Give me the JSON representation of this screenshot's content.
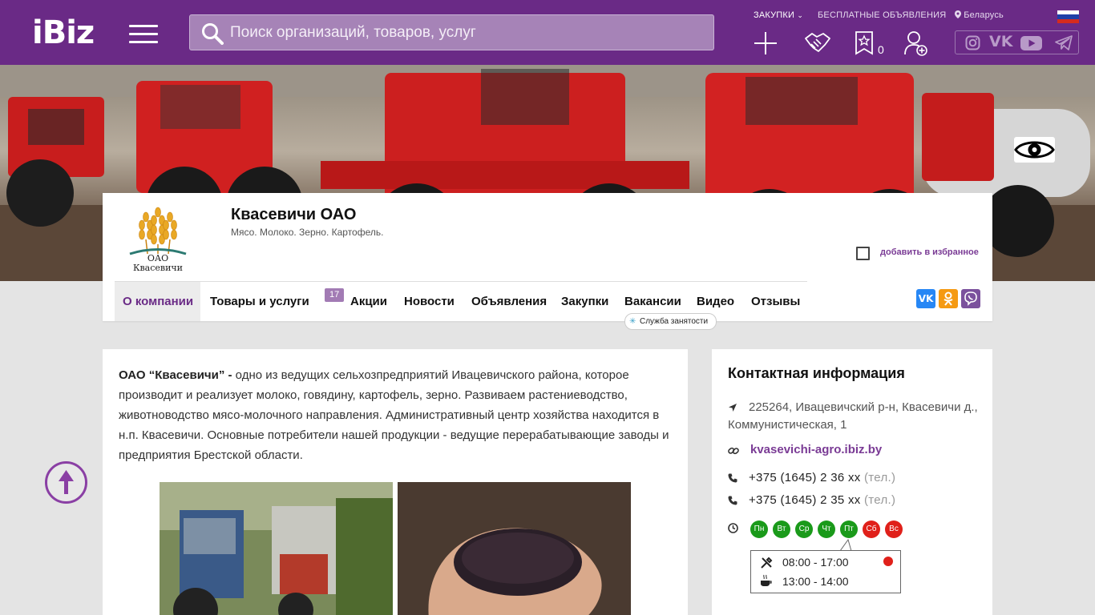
{
  "header": {
    "logo": "iBiz",
    "search_placeholder": "Поиск организаций, товаров, услуг",
    "links": {
      "procurement": "ЗАКУПКИ",
      "free_ads": "БЕСПЛАТНЫЕ ОБЪЯВЛЕНИЯ",
      "region": "Беларусь"
    },
    "favorites_count": "0",
    "colors": {
      "bar": "#6a2a86",
      "search": "#a683b7"
    }
  },
  "company": {
    "name": "Квасевичи ОАО",
    "tagline": "Мясо. Молоко. Зерно. Картофель.",
    "logo_text_1": "ОАО",
    "logo_text_2": "Квасевичи",
    "add_favorite": "добавить в избранное"
  },
  "tabs": [
    {
      "label": "О компании"
    },
    {
      "label": "Товары и услуги"
    },
    {
      "label": "Акции"
    },
    {
      "label": "Новости"
    },
    {
      "label": "Объявления"
    },
    {
      "label": "Закупки"
    },
    {
      "label": "Вакансии"
    },
    {
      "label": "Видео"
    },
    {
      "label": "Отзывы"
    }
  ],
  "tab_badge": "17",
  "service_tag": "Служба занятости",
  "about": {
    "lead": "ОАО “Квасевичи” -",
    "text": " одно из ведущих сельхозпредприятий Ивацевичского района, которое производит и реализует молоко, говядину, картофель, зерно. Развиваем растениеводство, животноводство мясо-молочного направления. Административный центр хозяйства находится в н.п. Квасевичи. Основные потребители нашей продукции - ведущие перерабатывающие заводы и предприятия Брестской области."
  },
  "contacts": {
    "title": "Контактная информация",
    "address": "225264, Ивацевичский р-н, Квасевичи д., Коммунистическая, 1",
    "site": "kvasevichi-agro.ibiz.by",
    "phones": [
      {
        "number": "+375 (1645) 2 36 xx",
        "note": "(тел.)"
      },
      {
        "number": "+375 (1645) 2 35 xx",
        "note": "(тел.)"
      }
    ],
    "days": [
      "Пн",
      "Вт",
      "Ср",
      "Чт",
      "Пт",
      "Сб",
      "Вс"
    ],
    "work_hours": "08:00 - 17:00",
    "break_hours": "13:00 - 14:00",
    "colors": {
      "workday": "#1a9a1a",
      "weekend": "#e0201a"
    }
  }
}
